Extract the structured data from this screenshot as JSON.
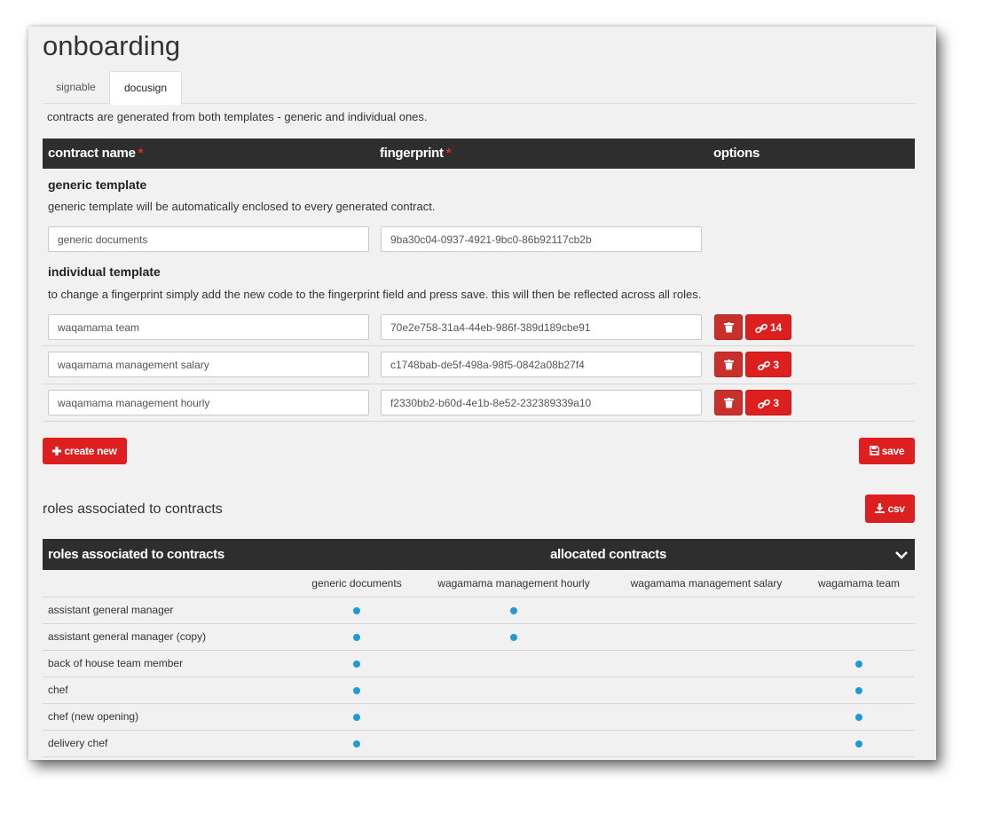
{
  "page": {
    "title": "onboarding"
  },
  "tabs": [
    {
      "label": "signable",
      "active": false
    },
    {
      "label": "docusign",
      "active": true
    }
  ],
  "intro": "contracts are generated from both templates - generic and individual ones.",
  "contracts_table": {
    "headers": {
      "name": "contract name",
      "fingerprint": "fingerprint",
      "options": "options",
      "required_mark": "*"
    }
  },
  "generic": {
    "title": "generic template",
    "description": "generic template will be automatically enclosed to every generated contract.",
    "name": "generic documents",
    "fingerprint": "9ba30c04-0937-4921-9bc0-86b92117cb2b"
  },
  "individual": {
    "title": "individual template",
    "description": "to change a fingerprint simply add the new code to the fingerprint field and press save. this will then be reflected across all roles.",
    "rows": [
      {
        "name": "waqamama team",
        "fingerprint": "70e2e758-31a4-44eb-986f-389d189cbe91",
        "links": "14"
      },
      {
        "name": "waqamama management salary",
        "fingerprint": "c1748bab-de5f-498a-98f5-0842a08b27f4",
        "links": "3"
      },
      {
        "name": "waqamama management hourly",
        "fingerprint": "f2330bb2-b60d-4e1b-8e52-232389339a10",
        "links": "3"
      }
    ]
  },
  "buttons": {
    "create_new": "create new",
    "save": "save",
    "csv": "csv"
  },
  "roles": {
    "section_title": "roles associated to contracts",
    "header_left": "roles associated to contracts",
    "header_center": "allocated contracts",
    "columns": [
      "generic documents",
      "wagamama management hourly",
      "wagamama management salary",
      "wagamama team"
    ],
    "rows": [
      {
        "name": "assistant general manager",
        "flags": [
          true,
          true,
          false,
          false
        ]
      },
      {
        "name": "assistant general manager (copy)",
        "flags": [
          true,
          true,
          false,
          false
        ]
      },
      {
        "name": "back of house team member",
        "flags": [
          true,
          false,
          false,
          true
        ]
      },
      {
        "name": "chef",
        "flags": [
          true,
          false,
          false,
          true
        ]
      },
      {
        "name": "chef (new opening)",
        "flags": [
          true,
          false,
          false,
          true
        ]
      },
      {
        "name": "delivery chef",
        "flags": [
          true,
          false,
          false,
          true
        ]
      }
    ]
  },
  "colors": {
    "accent": "#de1f1f",
    "header_bg": "#2e2e2e",
    "dot": "#1f9ad6"
  },
  "icons": [
    "trash-icon",
    "link-icon",
    "plus-icon",
    "save-icon",
    "download-icon",
    "chevron-down-icon"
  ]
}
